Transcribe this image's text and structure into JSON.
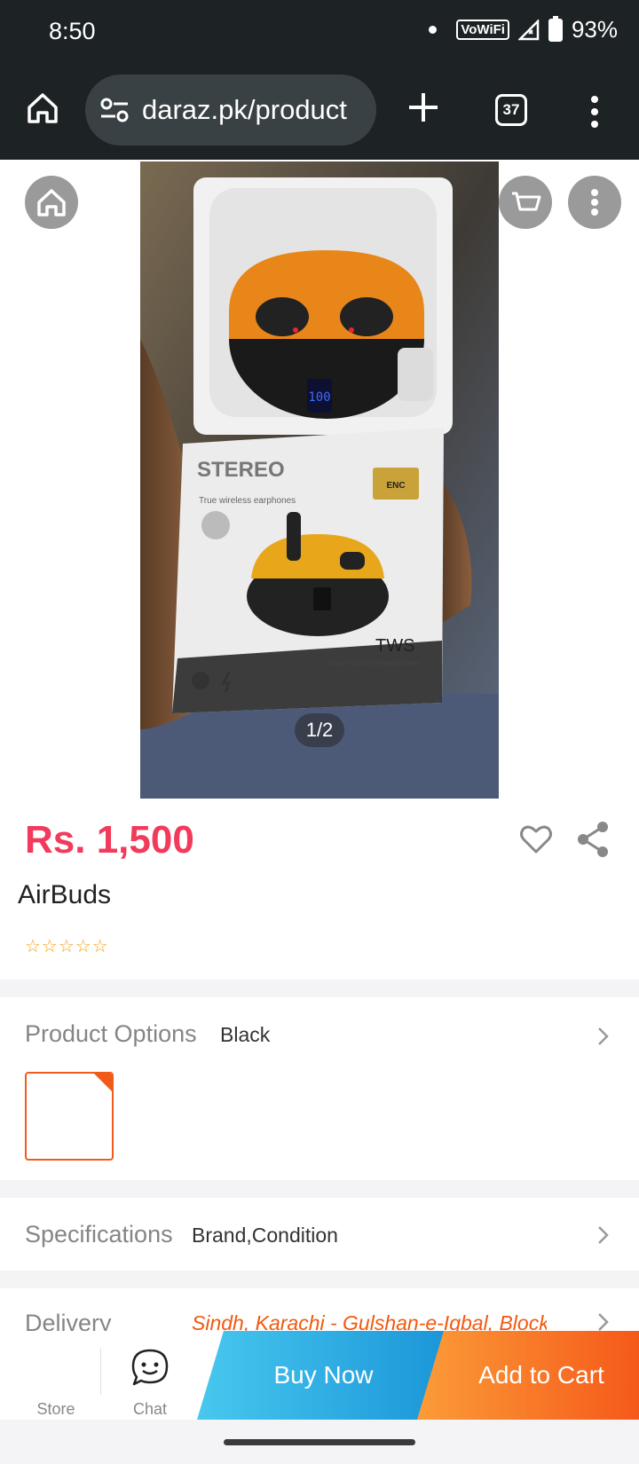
{
  "status_bar": {
    "time": "8:50",
    "vowifi": "VoWiFi",
    "battery": "93%"
  },
  "browser": {
    "url": "daraz.pk/product",
    "tab_count": "37"
  },
  "gallery": {
    "page_indicator": "1/2",
    "box_text": {
      "brand": "STEREO",
      "tagline": "True wireless earphones",
      "badge": "ENC",
      "model": "TWS",
      "model_sub": "Smart Sports Headphones",
      "case_display": "100"
    }
  },
  "product": {
    "price": "Rs. 1,500",
    "title": "AirBuds",
    "rating_stars": "☆☆☆☆☆"
  },
  "options": {
    "label": "Product Options",
    "value": "Black"
  },
  "specifications": {
    "label": "Specifications",
    "value": "Brand,Condition"
  },
  "delivery": {
    "label": "Delivery",
    "value": "Sindh, Karachi - Gulshan-e-Iqbal, Block"
  },
  "bottom_bar": {
    "store": "Store",
    "chat": "Chat",
    "buy_now": "Buy Now",
    "add_to_cart": "Add to Cart"
  },
  "colors": {
    "price": "#f23a5a",
    "accent_orange": "#f5591a",
    "accent_blue": "#1a95d8",
    "bar_dark": "#1d2225"
  }
}
